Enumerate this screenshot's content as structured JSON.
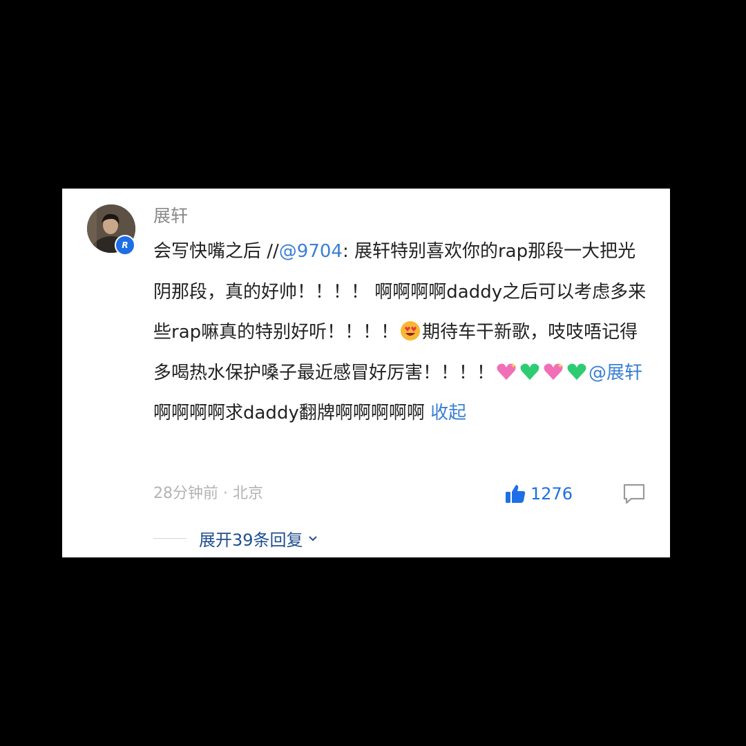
{
  "comment": {
    "username": "展轩",
    "badge_text": "R",
    "body": {
      "part1": "会写快嘴之后 //",
      "mention1": "@9704",
      "part2": ": 展轩特别喜欢你的rap那段一大把光阴那段，真的好帅！！！！ 啊啊啊啊daddy之后可以考虑多来些rap嘛真的特别好听！！！！",
      "part3": "期待车干新歌，吱吱唔记得多喝热水保护嗓子最近感冒好厉害！！！！",
      "mention2": "@展轩",
      "part4": " 啊啊啊啊求daddy翻牌啊啊啊啊啊",
      "collapse_label": "收起"
    },
    "emojis": [
      "heart-eyes-emoji",
      "sparkling-heart-emoji",
      "green-heart-emoji",
      "sparkling-heart-emoji",
      "green-heart-emoji"
    ],
    "timestamp": "28分钟前 · 北京",
    "like_count": "1276",
    "expand_replies_label": "展开39条回复"
  },
  "colors": {
    "link": "#3a7fd5",
    "like": "#1e6fe6",
    "meta": "#b3b3b3"
  }
}
